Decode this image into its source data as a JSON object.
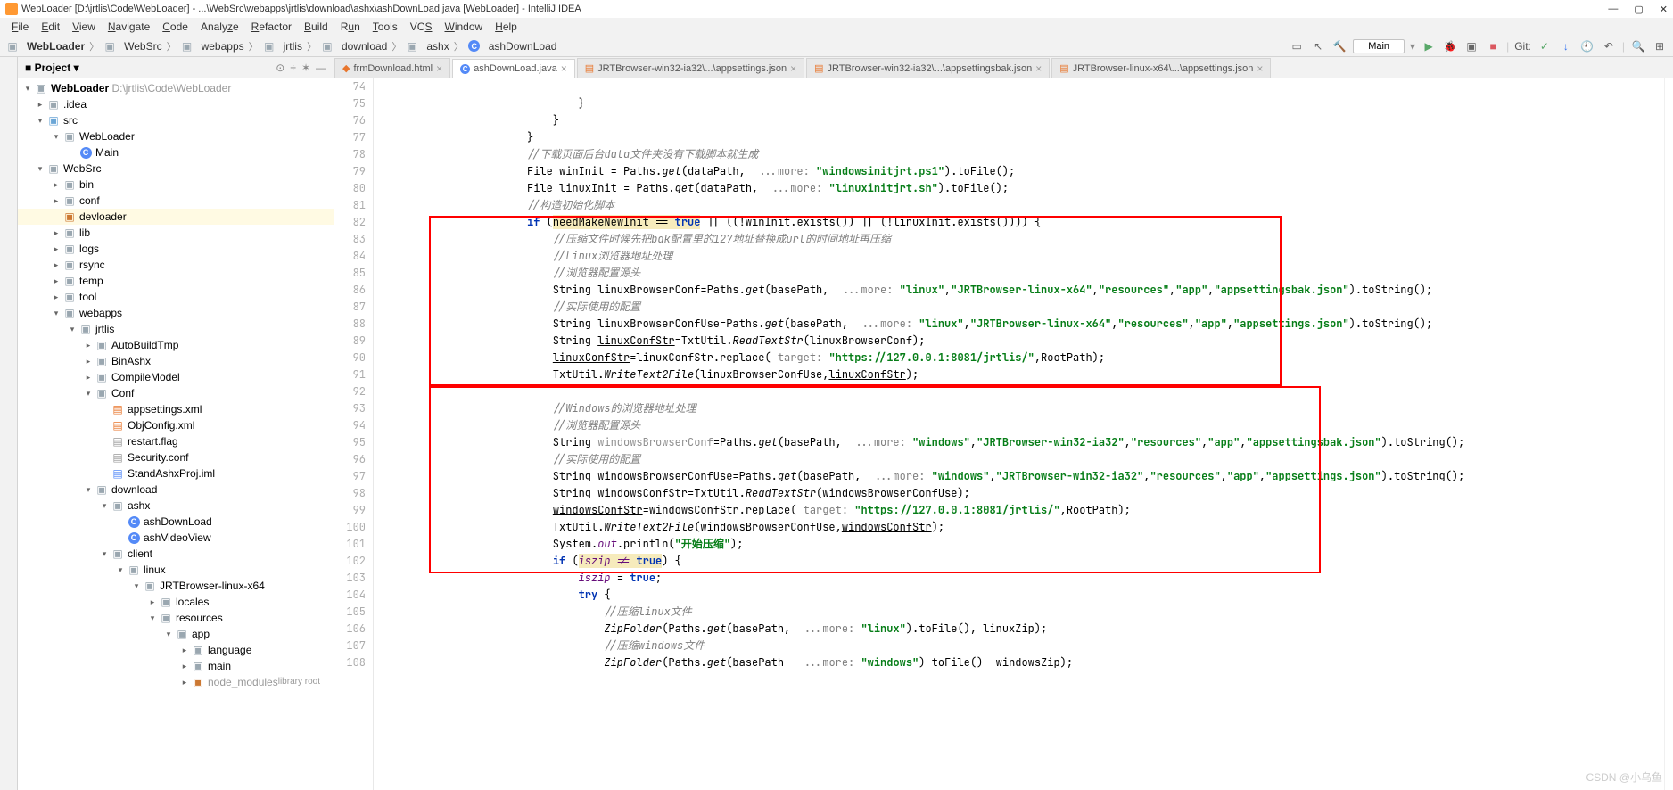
{
  "title": "WebLoader [D:\\jrtlis\\Code\\WebLoader] - ...\\WebSrc\\webapps\\jrtlis\\download\\ashx\\ashDownLoad.java [WebLoader] - IntelliJ IDEA",
  "menu": [
    "File",
    "Edit",
    "View",
    "Navigate",
    "Code",
    "Analyze",
    "Refactor",
    "Build",
    "Run",
    "Tools",
    "VCS",
    "Window",
    "Help"
  ],
  "breadcrumb": [
    "WebLoader",
    "WebSrc",
    "webapps",
    "jrtlis",
    "download",
    "ashx",
    "ashDownLoad"
  ],
  "run_config": "Main",
  "side_title": "Project",
  "tree": {
    "root": "WebLoader",
    "root_path": "D:\\jrtlis\\Code\\WebLoader",
    "idea": ".idea",
    "src": "src",
    "src_web": "WebLoader",
    "main_cls": "Main",
    "websrc": "WebSrc",
    "bin": "bin",
    "conf": "conf",
    "devloader": "devloader",
    "lib": "lib",
    "logs": "logs",
    "rsync": "rsync",
    "temp": "temp",
    "tool": "tool",
    "webapps": "webapps",
    "jrtlis": "jrtlis",
    "autobuild": "AutoBuildTmp",
    "binashx": "BinAshx",
    "compile": "CompileModel",
    "conf2": "Conf",
    "app_xml": "appsettings.xml",
    "obj_xml": "ObjConfig.xml",
    "restart": "restart.flag",
    "security": "Security.conf",
    "stand": "StandAshxProj.iml",
    "download": "download",
    "ashx": "ashx",
    "ashdown": "ashDownLoad",
    "ashvideo": "ashVideoView",
    "client": "client",
    "linux": "linux",
    "jrtbrowser": "JRTBrowser-linux-x64",
    "locales": "locales",
    "resources": "resources",
    "app": "app",
    "language": "language",
    "main": "main",
    "node_modules": "node_modules"
  },
  "tabs": [
    {
      "label": "frmDownload.html",
      "icon": "html"
    },
    {
      "label": "ashDownLoad.java",
      "icon": "class",
      "active": true
    },
    {
      "label": "JRTBrowser-win32-ia32\\...\\appsettings.json",
      "icon": "xml"
    },
    {
      "label": "JRTBrowser-win32-ia32\\...\\appsettingsbak.json",
      "icon": "xml"
    },
    {
      "label": "JRTBrowser-linux-x64\\...\\appsettings.json",
      "icon": "xml"
    }
  ],
  "code": {
    "lines": [
      74,
      75,
      76,
      77,
      78,
      79,
      80,
      81,
      82,
      83,
      84,
      85,
      86,
      87,
      88,
      89,
      90,
      91,
      92,
      93,
      94,
      95,
      96,
      97,
      98,
      99,
      100,
      101,
      102,
      103,
      104,
      105,
      106,
      107,
      108
    ],
    "l75": "                            }",
    "l76": "                        }",
    "l77": "                    }",
    "c78": "                    //下载页面后台data文件夹没有下载脚本就生成",
    "l79a": "                    File winInit = Paths.",
    "l79b": "get",
    "l79c": "(dataPath,  ",
    "l79more": "...more: ",
    "l79s": "\"windowsinitjrt.ps1\"",
    "l79d": ").toFile();",
    "l80a": "                    File linuxInit = Paths.",
    "l80b": "get",
    "l80c": "(dataPath,  ",
    "l80more": "...more: ",
    "l80s": "\"linuxinitjrt.sh\"",
    "l80d": ").toFile();",
    "c81": "                    //构造初始化脚本",
    "l82a": "                    ",
    "l82if": "if ",
    "l82b": "(",
    "l82warn": "needMakeNewInit == ",
    "l82true": "true",
    "l82c": " || ((!winInit.exists()) || (!linuxInit.exists()))) {",
    "c83": "                        //压缩文件时候先把bak配置里的127地址替换成url的时间地址再压缩",
    "c84": "                        //Linux浏览器地址处理",
    "c85": "                        //浏览器配置源头",
    "l86a": "                        String linuxBrowserConf=Paths.",
    "l86b": "get",
    "l86c": "(basePath,  ",
    "l86more": "...more: ",
    "l86s1": "\"linux\"",
    "l86s2": "\"JRTBrowser-linux-x64\"",
    "l86s3": "\"resources\"",
    "l86s4": "\"app\"",
    "l86s5": "\"appsettingsbak.json\"",
    "l86d": ").toString();",
    "c87": "                        //实际使用的配置",
    "l88a": "                        String linuxBrowserConfUse=Paths.",
    "l88b": "get",
    "l88c": "(basePath,  ",
    "l88more": "...more: ",
    "l88s1": "\"linux\"",
    "l88s2": "\"JRTBrowser-linux-x64\"",
    "l88s3": "\"resources\"",
    "l88s4": "\"app\"",
    "l88s5": "\"appsettings.json\"",
    "l88d": ").toString();",
    "l89a": "                        String ",
    "l89u": "linuxConfStr",
    "l89b": "=TxtUtil.",
    "l89fn": "ReadTextStr",
    "l89c": "(linuxBrowserConf);",
    "l90a": "                        ",
    "l90u": "linuxConfStr",
    "l90b": "=linuxConfStr.replace( ",
    "l90t": "target: ",
    "l90s": "\"https://127.0.0.1:8081/jrtlis/\"",
    "l90c": ",RootPath);",
    "l91a": "                        TxtUtil.",
    "l91fn": "WriteText2File",
    "l91b": "(linuxBrowserConfUse,",
    "l91u": "linuxConfStr",
    "l91c": ");",
    "c93": "                        //Windows的浏览器地址处理",
    "c94": "                        //浏览器配置源头",
    "l95a": "                        String ",
    "l95u": "windowsBrowserConf",
    "l95b": "=Paths.",
    "l95fn": "get",
    "l95c": "(basePath,  ",
    "l95more": "...more: ",
    "l95s1": "\"windows\"",
    "l95s2": "\"JRTBrowser-win32-ia32\"",
    "l95s3": "\"resources\"",
    "l95s4": "\"app\"",
    "l95s5": "\"appsettingsbak.json\"",
    "l95d": ").toString();",
    "c96": "                        //实际使用的配置",
    "l97a": "                        String windowsBrowserConfUse=Paths.",
    "l97fn": "get",
    "l97c": "(basePath,  ",
    "l97more": "...more: ",
    "l97s1": "\"windows\"",
    "l97s2": "\"JRTBrowser-win32-ia32\"",
    "l97s3": "\"resources\"",
    "l97s4": "\"app\"",
    "l97s5": "\"appsettings.json\"",
    "l97d": ").toString();",
    "l98a": "                        String ",
    "l98u": "windowsConfStr",
    "l98b": "=TxtUtil.",
    "l98fn": "ReadTextStr",
    "l98c": "(windowsBrowserConfUse);",
    "l99a": "                        ",
    "l99u": "windowsConfStr",
    "l99b": "=windowsConfStr.replace( ",
    "l99t": "target: ",
    "l99s": "\"https://127.0.0.1:8081/jrtlis/\"",
    "l99c": ",RootPath);",
    "l100a": "                        TxtUtil.",
    "l100fn": "WriteText2File",
    "l100b": "(windowsBrowserConfUse,",
    "l100u": "windowsConfStr",
    "l100c": ");",
    "l101a": "                        System.",
    "l101o": "out",
    "l101b": ".println(",
    "l101s": "\"开始压缩\"",
    "l101c": ");",
    "l102a": "                        ",
    "l102if": "if ",
    "l102b": "(",
    "l102warn": "iszip != ",
    "l102true": "true",
    "l102c": ") {",
    "l103a": "                            ",
    "l103v": "iszip",
    "l103b": " = ",
    "l103true": "true",
    "l103c": ";",
    "l104a": "                            ",
    "l104try": "try ",
    "l104b": "{",
    "c105": "                                //压缩linux文件",
    "l106a": "                                ",
    "l106fn": "ZipFolder",
    "l106b": "(Paths.",
    "l106fn2": "get",
    "l106c": "(basePath,  ",
    "l106more": "...more: ",
    "l106s": "\"linux\"",
    "l106d": ").toFile(), linuxZip);",
    "c107": "                                //压缩windows文件",
    "l108a": "                                ",
    "l108fn": "ZipFolder",
    "l108b": "(Paths.",
    "l108fn2": "get",
    "l108c": "(basePath   ",
    "l108more": "...more: ",
    "l108s": "\"windows\"",
    "l108d": ") toFile()  windowsZip);"
  },
  "watermark": "CSDN @小乌鱼"
}
